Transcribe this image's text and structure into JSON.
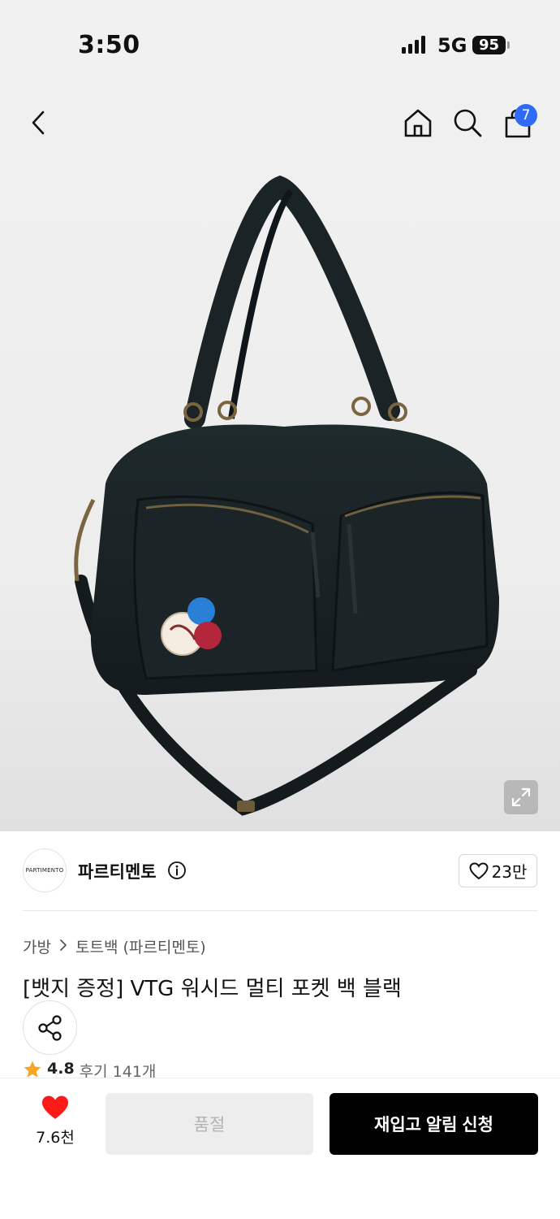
{
  "status_bar": {
    "time": "3:50",
    "network": "5G",
    "battery": "95"
  },
  "header": {
    "back_icon": "chevron-left-icon",
    "home_icon": "home-icon",
    "search_icon": "search-icon",
    "cart_icon": "shopping-bag-icon",
    "cart_count": "7",
    "badge_color": "#2f6bf6"
  },
  "brand": {
    "logo_text": "PARTIMENTO",
    "name": "파르티멘토",
    "likes": "23만"
  },
  "breadcrumb": {
    "category": "가방",
    "subcategory": "토트백 (파르티멘토)"
  },
  "product": {
    "title": "[뱃지 증정] VTG 워시드 멀티 포켓 백 블랙",
    "rating": "4.8",
    "reviews": "후기 141개"
  },
  "bottom_bar": {
    "wish_count": "7.6천",
    "soldout_label": "품절",
    "restock_label": "재입고 알림 신청",
    "heart_color": "#ff1a1a"
  }
}
